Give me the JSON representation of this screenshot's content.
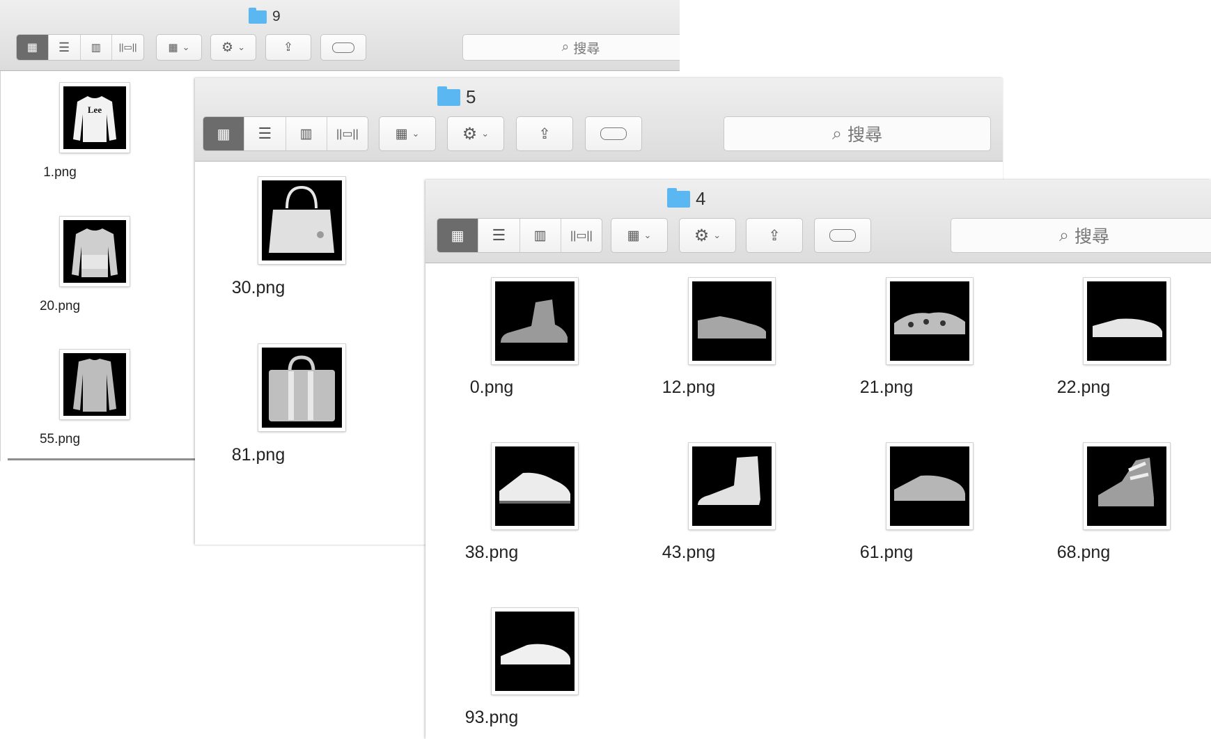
{
  "windows": {
    "w9": {
      "title": "9",
      "search_placeholder": "搜尋",
      "files": [
        {
          "name": "1.png",
          "image": "lee-sweatshirt"
        },
        {
          "name": "20.png",
          "image": "sweater"
        },
        {
          "name": "55.png",
          "image": "pullover"
        }
      ]
    },
    "w5": {
      "title": "5",
      "search_placeholder": "搜尋",
      "files": [
        {
          "name": "30.png",
          "image": "handbag"
        },
        {
          "name": "81.png",
          "image": "tote-bag"
        }
      ]
    },
    "w4": {
      "title": "4",
      "search_placeholder": "搜尋",
      "files": [
        {
          "name": "0.png",
          "image": "ankle-boot"
        },
        {
          "name": "12.png",
          "image": "sneaker"
        },
        {
          "name": "21.png",
          "image": "sandal"
        },
        {
          "name": "22.png",
          "image": "sneaker"
        },
        {
          "name": "38.png",
          "image": "sneaker"
        },
        {
          "name": "43.png",
          "image": "high-top-boot"
        },
        {
          "name": "61.png",
          "image": "sneaker"
        },
        {
          "name": "68.png",
          "image": "sandal"
        },
        {
          "name": "93.png",
          "image": "sneaker"
        }
      ]
    }
  },
  "colors": {
    "folder": "#5ab7f2",
    "selected_view": "#6c6c6c",
    "thumbnail_bg": "#000000"
  }
}
